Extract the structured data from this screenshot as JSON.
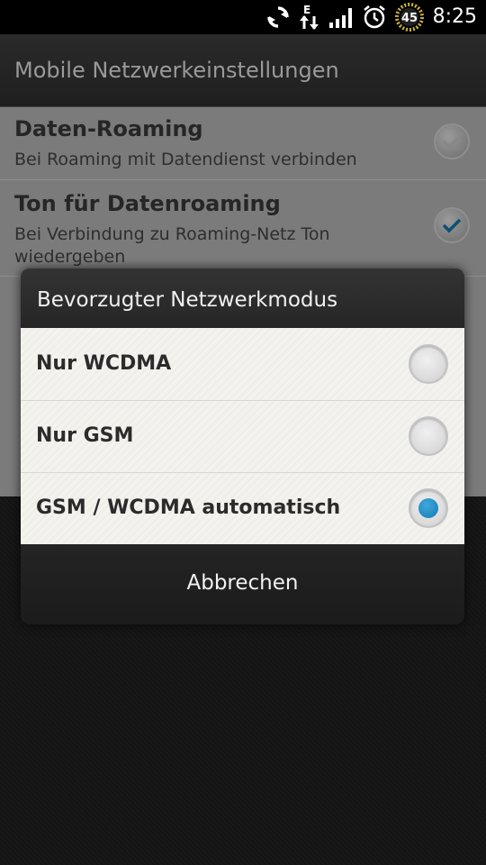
{
  "status_bar": {
    "time": "8:25",
    "network_type": "E",
    "battery_level": "45",
    "icons": [
      "sync-icon",
      "data-transfer-icon",
      "signal-icon",
      "alarm-icon",
      "battery-icon"
    ]
  },
  "app_bar": {
    "title": "Mobile Netzwerkeinstellungen"
  },
  "settings": [
    {
      "title": "Daten-Roaming",
      "subtitle": "Bei Roaming mit Datendienst verbinden",
      "checked": false
    },
    {
      "title": "Ton für Datenroaming",
      "subtitle": "Bei Verbindung zu Roaming-Netz Ton wiedergeben",
      "checked": true
    }
  ],
  "dialog": {
    "title": "Bevorzugter Netzwerkmodus",
    "options": [
      {
        "label": "Nur WCDMA",
        "selected": false
      },
      {
        "label": "Nur GSM",
        "selected": false
      },
      {
        "label": "GSM / WCDMA automatisch",
        "selected": true
      }
    ],
    "cancel_label": "Abbrechen"
  },
  "colors": {
    "accent": "#1a86c0",
    "dialog_option_bg": "#f4f3ef"
  }
}
